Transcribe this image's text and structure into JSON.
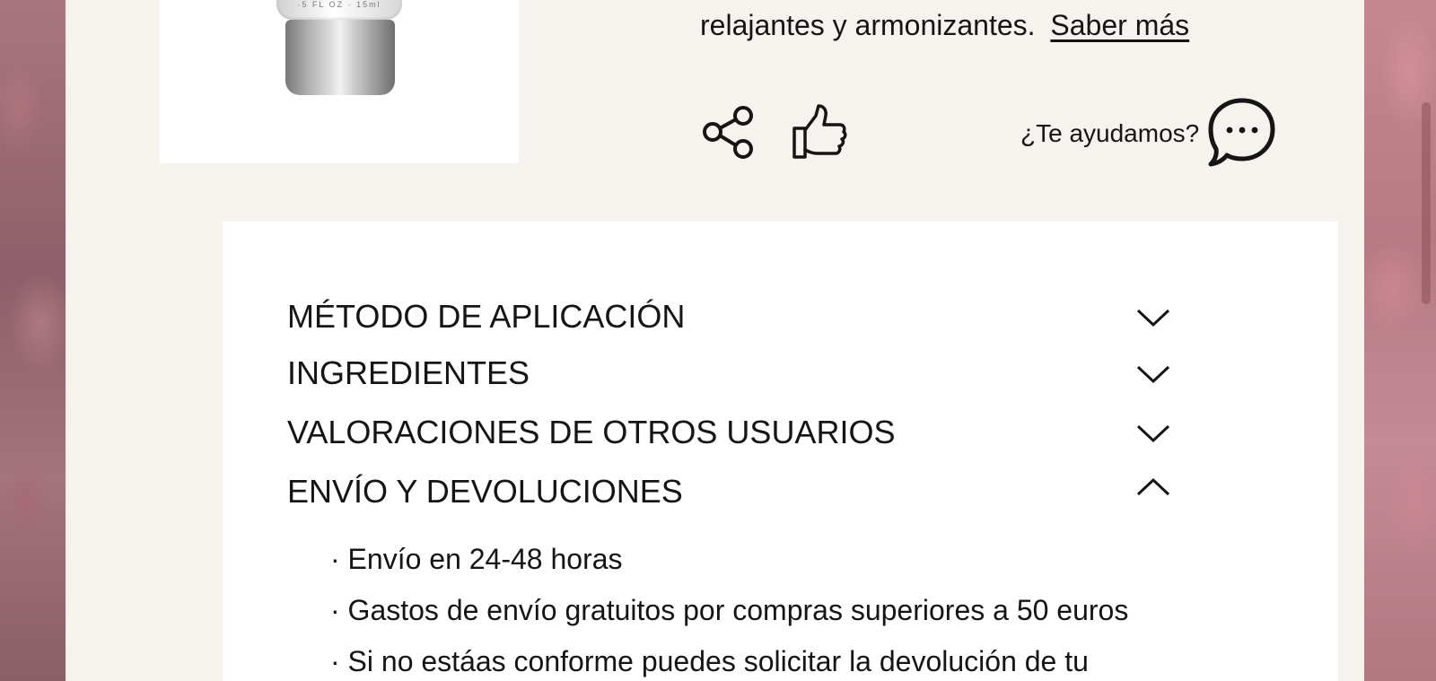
{
  "product": {
    "image_alt": "Producto",
    "bottle_label": "·5 FL OZ · 15ml",
    "description_line": "relajantes y armonizantes.",
    "saber_mas": "Saber más"
  },
  "actions": {
    "help_text": "¿Te ayudamos?"
  },
  "accordion": {
    "items": [
      {
        "label": "MÉTODO DE APLICACIÓN",
        "expanded": false
      },
      {
        "label": "INGREDIENTES",
        "expanded": false
      },
      {
        "label": "VALORACIONES DE OTROS USUARIOS",
        "expanded": false
      },
      {
        "label": "ENVÍO Y DEVOLUCIONES",
        "expanded": true
      }
    ],
    "shipping_details": [
      "· Envío en 24-48 horas",
      "· Gastos de envío gratuitos por compras superiores a 50 euros",
      "· Si no estáas conforme puedes solicitar la devolución de tu"
    ]
  },
  "colors": {
    "panel_bg": "#f6f3ef",
    "card_bg": "#ffffff",
    "text": "#151515",
    "backdrop": "#9d6f78"
  }
}
